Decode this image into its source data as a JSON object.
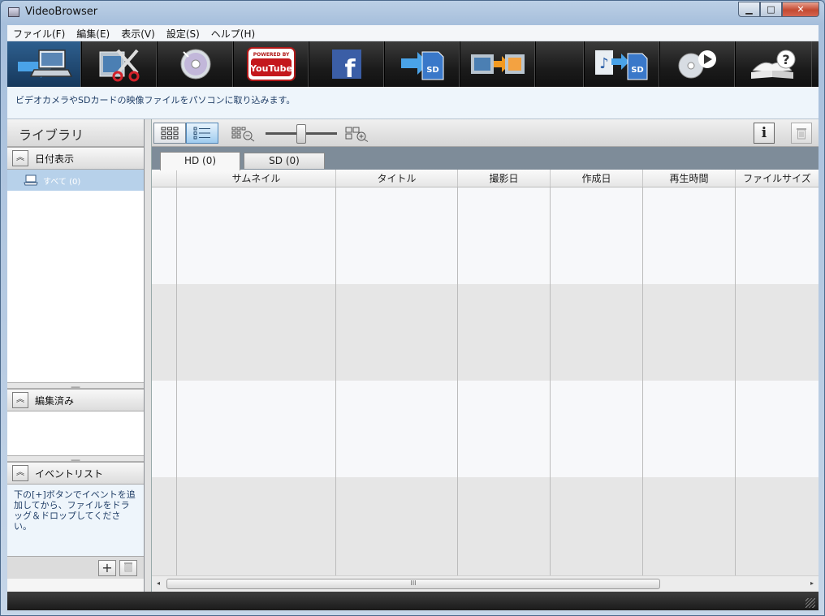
{
  "window": {
    "title": "VideoBrowser",
    "min": "▁",
    "max": "□",
    "close": "✕"
  },
  "menu": [
    "ファイル(F)",
    "編集(E)",
    "表示(V)",
    "設定(S)",
    "ヘルプ(H)"
  ],
  "toolbar": {
    "youtube_top": "POWERED BY",
    "youtube_label": "YouTube",
    "sd": "SD",
    "facebook": "f"
  },
  "info": {
    "text": "ビデオカメラやSDカードの映像ファイルをパソコンに取り込みます。"
  },
  "library": {
    "title": "ライブラリ",
    "sections": {
      "date_view": "日付表示",
      "all_item": "すべて (0)",
      "edited": "編集済み",
      "event_list": "イベントリスト"
    },
    "event_hint": "下の[+]ボタンでイベントを追加してから、ファイルをドラッグ＆ドロップしてください。",
    "add": "+",
    "collapse": "︽"
  },
  "view": {
    "info_btn": "i"
  },
  "tabs": [
    {
      "label": "HD (0)",
      "active": true
    },
    {
      "label": "SD (0)",
      "active": false
    }
  ],
  "table": {
    "columns": [
      "",
      "サムネイル",
      "タイトル",
      "撮影日",
      "作成日",
      "再生時間",
      "ファイルサイズ"
    ]
  },
  "scroll": {
    "left": "◂",
    "right": "▸",
    "thumb": "III"
  },
  "colors": {
    "accent": "#2e5f8e",
    "selection": "#b7d1ea",
    "info_text": "#1f3d66"
  }
}
